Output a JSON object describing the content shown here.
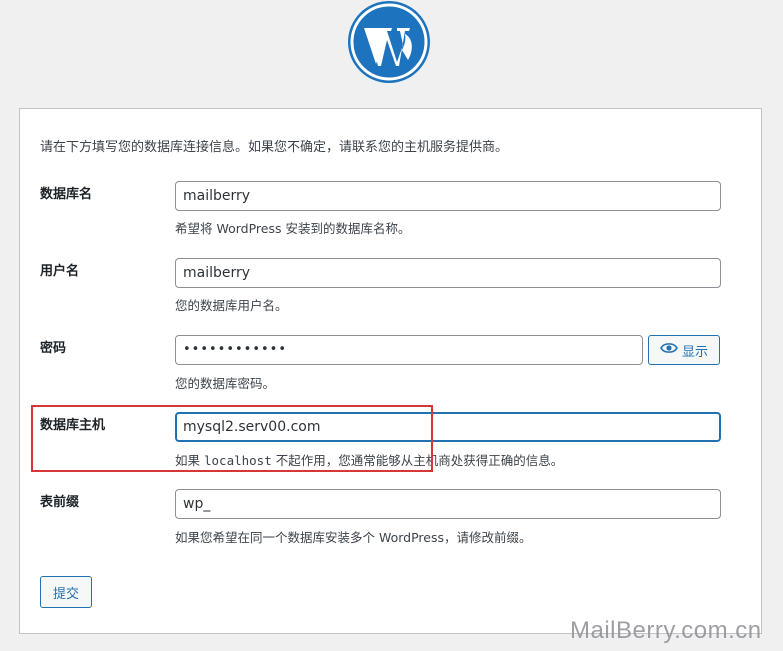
{
  "intro_text": "请在下方填写您的数据库连接信息。如果您不确定，请联系您的主机服务提供商。",
  "fields": {
    "dbname": {
      "label": "数据库名",
      "value": "mailberry",
      "help": "希望将 WordPress 安装到的数据库名称。"
    },
    "uname": {
      "label": "用户名",
      "value": "mailberry",
      "help": "您的数据库用户名。"
    },
    "pwd": {
      "label": "密码",
      "value": "••••••••••••",
      "help": "您的数据库密码。",
      "show_label": "显示"
    },
    "dbhost": {
      "label": "数据库主机",
      "value": "mysql2.serv00.com",
      "help_prefix": "如果",
      "help_code": "localhost",
      "help_suffix": "不起作用，您通常能够从主机商处获得正确的信息。"
    },
    "prefix": {
      "label": "表前缀",
      "value": "wp_",
      "help": "如果您希望在同一个数据库安装多个 WordPress，请修改前缀。"
    }
  },
  "submit_label": "提交",
  "watermark": "MailBerry.com.cn",
  "colors": {
    "accent": "#2271b1",
    "logo": "#1e73be",
    "highlight": "#d63638"
  },
  "icons": {
    "logo": "wordpress-logo-icon",
    "show": "eye-icon"
  }
}
